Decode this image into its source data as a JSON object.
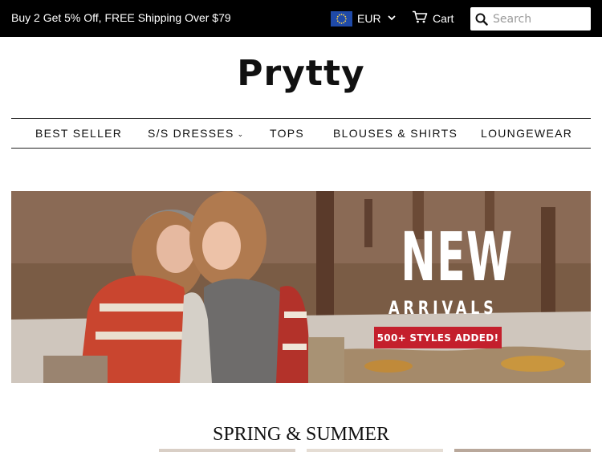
{
  "announcement": {
    "promo_text": "Buy 2 Get 5% Off, FREE Shipping Over $79"
  },
  "currency": {
    "selected": "EUR",
    "flag_icon": "eu-flag-icon",
    "chevron_icon": "chevron-down-icon"
  },
  "cart": {
    "label": "Cart",
    "icon": "cart-icon"
  },
  "search": {
    "placeholder": "Search",
    "value": "",
    "icon": "search-icon"
  },
  "logo": {
    "text": "Prytty"
  },
  "nav": {
    "items": [
      {
        "label": "BEST SELLER"
      },
      {
        "label": "S/S DRESSES",
        "has_dropdown": true
      },
      {
        "label": "TOPS"
      },
      {
        "label": "BLOUSES & SHIRTS"
      },
      {
        "label": "LOUNGEWEAR"
      }
    ]
  },
  "hero": {
    "headline": "NEW",
    "subheadline": "ARRIVALS",
    "badge": "500+ STYLES ADDED!",
    "badge_color": "#c41f2c"
  },
  "section": {
    "title": "SPRING & SUMMER"
  },
  "colors": {
    "topbar_bg": "#000000",
    "text": "#111111",
    "accent": "#c41f2c"
  }
}
